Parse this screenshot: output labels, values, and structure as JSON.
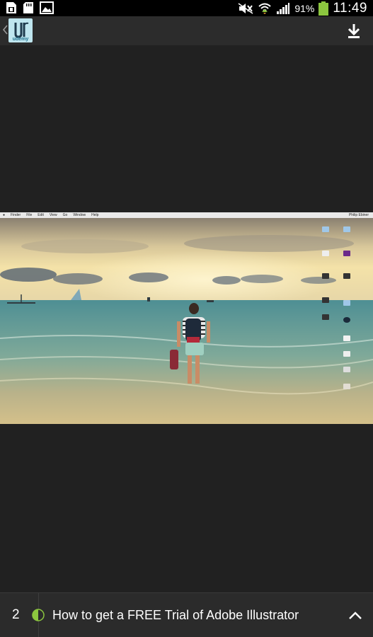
{
  "status_bar": {
    "battery_percent": "91%",
    "time": "11:49",
    "icons": [
      "sim-card-icon",
      "sd-card-icon",
      "image-icon",
      "mute-icon",
      "wifi-icon",
      "signal-icon",
      "battery-icon"
    ]
  },
  "action_bar": {
    "app_logo_text": "udemy",
    "icons": [
      "up-chevron-icon",
      "download-icon"
    ]
  },
  "media": {
    "desktop_menubar": {
      "items": [
        "Finder",
        "File",
        "Edit",
        "View",
        "Go",
        "Window",
        "Help"
      ],
      "right_text": "Philip Ebiner"
    }
  },
  "bottom_bar": {
    "lecture_index": "2",
    "lecture_title": "How to get a FREE Trial of Adobe Illustrator",
    "progress_fraction": 0.5,
    "accent_color": "#8cc63f",
    "icons": [
      "progress-half-icon",
      "chevron-up-icon"
    ]
  }
}
